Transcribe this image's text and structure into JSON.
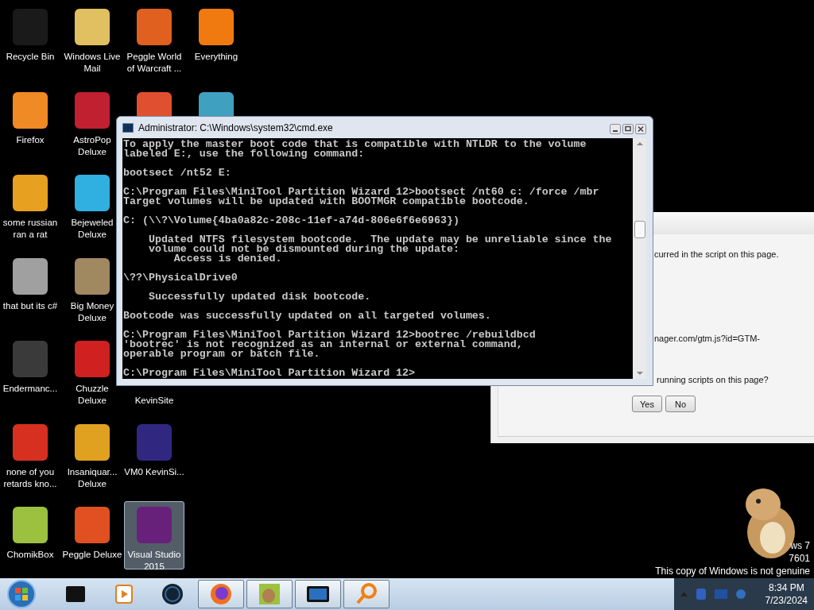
{
  "desktop": {
    "icons": [
      {
        "label": "Recycle Bin",
        "color": "#1a1a1a",
        "selected": false
      },
      {
        "label": "Firefox",
        "color": "#f08a24",
        "selected": false
      },
      {
        "label": "some russian ran a rat",
        "color": "#e8a020",
        "selected": false
      },
      {
        "label": "that but its c#",
        "color": "#a0a0a0",
        "selected": false
      },
      {
        "label": "Endermanc...",
        "color": "#3a3a3a",
        "selected": false
      },
      {
        "label": "none of you retards kno...",
        "color": "#d83020",
        "selected": false
      },
      {
        "label": "ChomikBox",
        "color": "#9cc040",
        "selected": false
      },
      {
        "label": "Windows Live Mail",
        "color": "#e0c060",
        "selected": false
      },
      {
        "label": "AstroPop Deluxe",
        "color": "#c02030",
        "selected": false
      },
      {
        "label": "Bejeweled Deluxe",
        "color": "#30b0e0",
        "selected": false
      },
      {
        "label": "Big Money Deluxe",
        "color": "#a08860",
        "selected": false
      },
      {
        "label": "Chuzzle Deluxe",
        "color": "#d02020",
        "selected": false
      },
      {
        "label": "Insaniquar... Deluxe",
        "color": "#e0a020",
        "selected": false
      },
      {
        "label": "Peggle Deluxe",
        "color": "#e05020",
        "selected": false
      },
      {
        "label": "Peggle World of Warcraft ...",
        "color": "#e06020",
        "selected": false
      },
      {
        "color": "#e05030",
        "selected": false
      },
      {
        "label": "KevinSite",
        "selected": false
      },
      {
        "label": "VM0 KevinSi...",
        "color": "#302880",
        "selected": false
      },
      {
        "label": "Visual Studio 2015",
        "color": "#68217a",
        "selected": true
      },
      {
        "label": "Everything",
        "color": "#f07a10",
        "selected": false
      },
      {
        "color": "#40a0c0",
        "selected": false
      }
    ]
  },
  "script_dialog": {
    "lines": [
      "curred in the script on this page.",
      "nager.com/gtm.js?id=GTM-",
      "running scripts on this page?"
    ],
    "buttons": [
      "Yes",
      "No"
    ]
  },
  "console": {
    "title": "Administrator: C:\\Windows\\system32\\cmd.exe",
    "blocks": [
      [
        "To apply the master boot code that is compatible with NTLDR to the volume",
        "labeled E:, use the following command:"
      ],
      [
        "bootsect /nt52 E:"
      ],
      [
        "C:\\Program Files\\MiniTool Partition Wizard 12>bootsect /nt60 c: /force /mbr",
        "Target volumes will be updated with BOOTMGR compatible bootcode."
      ],
      [
        "C: (\\\\?\\Volume{4ba0a82c-208c-11ef-a74d-806e6f6e6963})"
      ],
      [
        "    Updated NTFS filesystem bootcode.  The update may be unreliable since the",
        "    volume could not be dismounted during the update:",
        "        Access is denied."
      ],
      [
        "\\??\\PhysicalDrive0"
      ],
      [
        "    Successfully updated disk bootcode."
      ],
      [
        "Bootcode was successfully updated on all targeted volumes."
      ],
      [
        "C:\\Program Files\\MiniTool Partition Wizard 12>bootrec /rebuildbcd",
        "'bootrec' is not recognized as an internal or external command,",
        "operable program or batch file."
      ],
      [
        "C:\\Program Files\\MiniTool Partition Wizard 12>"
      ]
    ]
  },
  "watermark": {
    "lines": [
      "ws 7",
      "7601",
      "This copy of Windows is not genuine"
    ]
  },
  "taskbar": {
    "items": [
      {
        "kind": "device",
        "selected": false
      },
      {
        "kind": "media",
        "selected": false
      },
      {
        "kind": "globe",
        "selected": false
      },
      {
        "kind": "browser",
        "selected": true
      },
      {
        "kind": "hamster",
        "selected": true
      },
      {
        "kind": "monitor",
        "selected": true
      },
      {
        "kind": "search",
        "selected": true
      }
    ],
    "clock": {
      "time": "8:34 PM",
      "date": "7/23/2024"
    }
  }
}
